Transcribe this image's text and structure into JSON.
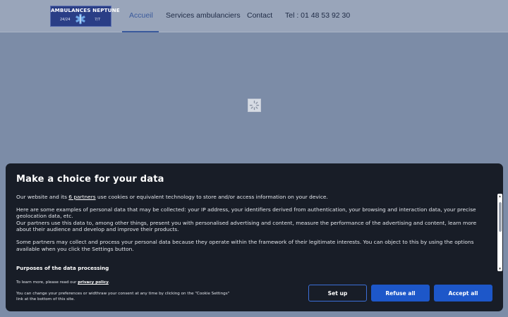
{
  "logo": {
    "title": "AMBULANCES NEPTUNE",
    "left_text": "24/24",
    "right_text": "7/7",
    "icon": "star-of-life-icon"
  },
  "nav": {
    "items": [
      {
        "label": "Accueil",
        "active": true
      },
      {
        "label": "Services ambulanciers",
        "active": false
      },
      {
        "label": "Contact",
        "active": false
      },
      {
        "label": "Tel : 01 48 53 92 30",
        "active": false
      }
    ],
    "active_color": "#3a5a9c"
  },
  "cookie": {
    "title": "Make a choice for your data",
    "para1_prefix": "Our website and its ",
    "para1_link": "6 partners",
    "para1_suffix": " use cookies or equivalent technology to store and/or access information on your device.",
    "para2": "Here are some examples of personal data that may be collected: your IP address, your identifiers derived from authentication, your browsing and interaction data, your precise geolocation data, etc.",
    "para3": "Our partners use this data to, among other things, present you with personalised advertising and content, measure the performance of the advertising and content, learn more about their audience and develop and improve their products.",
    "para4": "Some partners may collect and process your personal data because they operate within the framework of their legitimate interests. You can object to this by using the options available when you click the Settings button.",
    "purposes_title": "Purposes of the data processing",
    "learn_more_prefix": "To learn more, please read our ",
    "learn_more_link": "privacy policy",
    "learn_more_suffix": ".",
    "change_pref": "You can change your preferences or widthraw your consent at any time by clicking on the \"Cookie Settings\" link at the bottom of this site.",
    "buttons": {
      "setup": "Set up",
      "refuse": "Refuse all",
      "accept": "Accept all"
    },
    "button_color": "#1d57c9"
  }
}
